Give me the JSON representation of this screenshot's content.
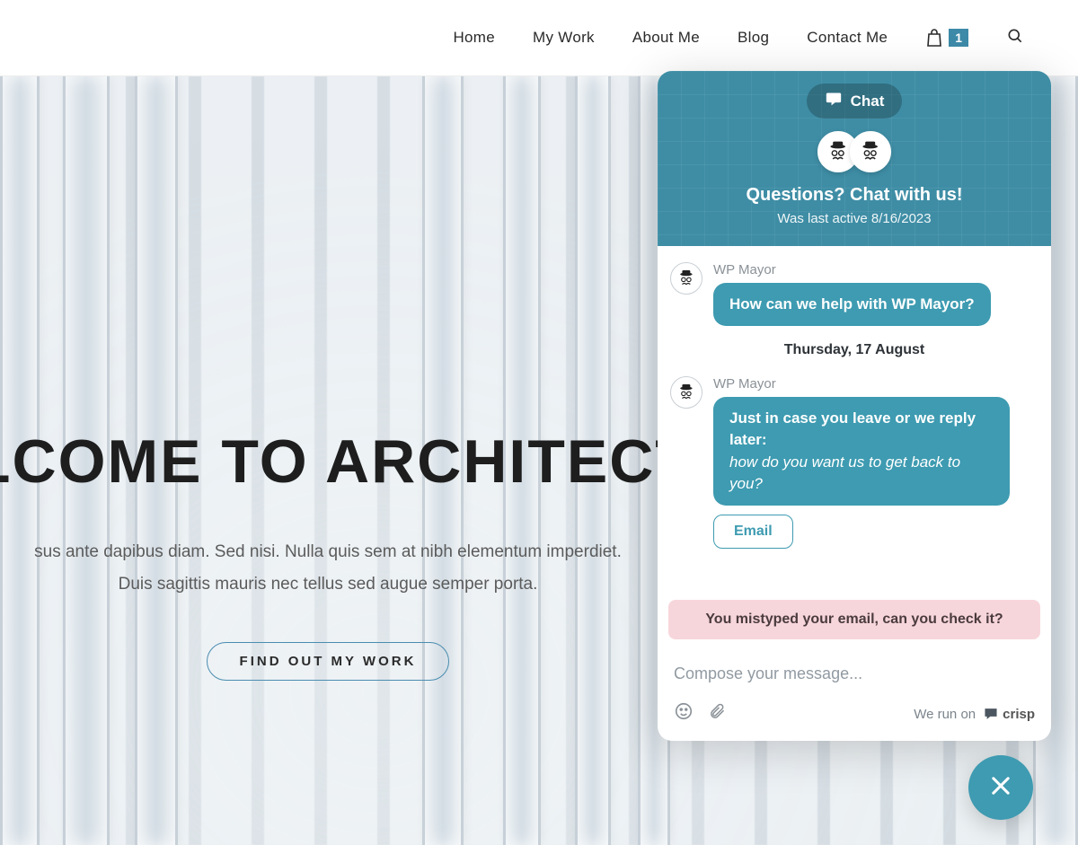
{
  "nav": {
    "items": [
      {
        "label": "Home"
      },
      {
        "label": "My Work"
      },
      {
        "label": "About Me"
      },
      {
        "label": "Blog"
      },
      {
        "label": "Contact Me"
      }
    ],
    "cart_count": "1"
  },
  "hero": {
    "title": "LCOME TO ARCHITECT",
    "subtitle_line1": "sus ante dapibus diam. Sed nisi. Nulla quis sem at nibh elementum imperdiet.",
    "subtitle_line2": "Duis sagittis mauris nec tellus sed augue semper porta.",
    "cta": "FIND OUT MY WORK"
  },
  "chat": {
    "pill_label": "Chat",
    "header_title": "Questions? Chat with us!",
    "header_sub": "Was last active 8/16/2023",
    "sender": "WP Mayor",
    "msg1": "How can we help with WP Mayor?",
    "date_separator": "Thursday, 17 August",
    "msg2_line1": "Just in case you leave or we reply later:",
    "msg2_line2": "how do you want us to get back to you?",
    "option_email": "Email",
    "error": "You mistyped your email, can you check it?",
    "input_placeholder": "Compose your message...",
    "footer_text": "We run on",
    "footer_brand": "crisp"
  },
  "colors": {
    "teal": "#3e9bb1",
    "header_teal": "#3e8da5",
    "error_bg": "#f7d6db"
  }
}
